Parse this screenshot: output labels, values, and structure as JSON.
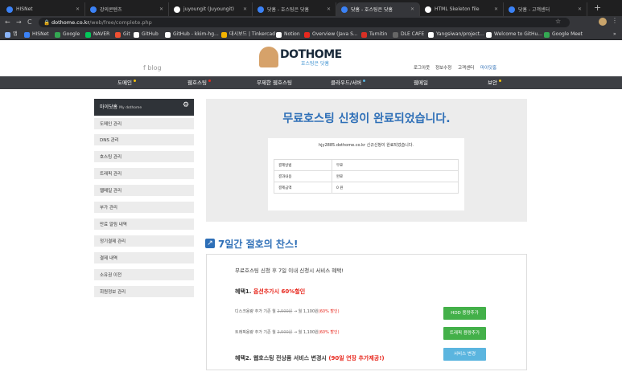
{
  "browser": {
    "tabs": [
      {
        "title": "HISNet",
        "color": "#3b82f6"
      },
      {
        "title": "강의콘텐츠",
        "color": "#3b82f6"
      },
      {
        "title": "juyoungit (Juyoungit)",
        "color": "#ffffff"
      },
      {
        "title": "닷홈 - 호스팅은 닷홈",
        "color": "#3b82f6"
      },
      {
        "title": "닷홈 - 호스팅은 닷홈",
        "color": "#3b82f6"
      },
      {
        "title": "HTML Skeleton file",
        "color": "#ffffff"
      },
      {
        "title": "닷홈 - 고객센터",
        "color": "#3b82f6"
      }
    ],
    "new_tab": "+",
    "back": "←",
    "forward": "→",
    "reload": "C",
    "url_host": "dothome.co.kr",
    "url_path": "/web/free/complete.php",
    "bookmarks": [
      {
        "label": "앱",
        "color": "#8ab4f8"
      },
      {
        "label": "HISNet",
        "color": "#3b82f6"
      },
      {
        "label": "Google",
        "color": "#34a853"
      },
      {
        "label": "NAVER",
        "color": "#03c75a"
      },
      {
        "label": "Git",
        "color": "#f05032"
      },
      {
        "label": "GitHub",
        "color": "#ffffff"
      },
      {
        "label": "GitHub - kkim-hg...",
        "color": "#ffffff"
      },
      {
        "label": "대시보드 | Tinkercad",
        "color": "#f4b400"
      },
      {
        "label": "Notion",
        "color": "#ffffff"
      },
      {
        "label": "Overview (Java S...",
        "color": "#e8281e"
      },
      {
        "label": "Turnitin",
        "color": "#d93025"
      },
      {
        "label": "DLE CAFE",
        "color": "#666666"
      },
      {
        "label": "Yangsiwan/project...",
        "color": "#ffffff"
      },
      {
        "label": "Welcome to GitHu...",
        "color": "#ffffff"
      },
      {
        "label": "Google Meet",
        "color": "#34a853"
      }
    ],
    "more": "»"
  },
  "site": {
    "logo_text": "DOTHOME",
    "logo_sub": "호스팅은 닷홈",
    "blog": "f  blog",
    "top_links": [
      "로그아웃",
      "정보수정",
      "고객센터",
      "마이닷홈"
    ],
    "nav": [
      {
        "label": "도메인",
        "dot": "#f4c20d"
      },
      {
        "label": "웹호스팅",
        "dot": "#e8281e"
      },
      {
        "label": "무제한 웹호스팅",
        "dot": ""
      },
      {
        "label": "클라우드/서버",
        "dot": "#5bb5df"
      },
      {
        "label": "웹메일",
        "dot": ""
      },
      {
        "label": "보안",
        "dot": "#f4c20d"
      }
    ]
  },
  "sidebar": {
    "title": "마이닷홈",
    "title_sub": "My dothome",
    "items": [
      "도메인 관리",
      "DNS 관리",
      "호스팅 관리",
      "트래픽 관리",
      "웹메일 관리",
      "부가 관리",
      "만료 알림 내역",
      "정기결제 관리",
      "결제 내역",
      "소유권 이전",
      "회원정보 관리"
    ]
  },
  "main": {
    "title": "무료호스팅 신청이 완료되었습니다.",
    "notice": "hjy2885.dothome.co.kr 신규신청이 완료되었습니다.",
    "rows": [
      {
        "label": "결제방법",
        "value": "무료"
      },
      {
        "label": "결과내용",
        "value": "완료"
      },
      {
        "label": "결제금액",
        "value": "0 원"
      }
    ]
  },
  "promo": {
    "title": "7일간 절호의 찬스!",
    "lead": "무료호스팅 신청 후 7일 이내 신청시 서비스 혜택!",
    "benefit1_prefix": "혜택1. ",
    "benefit1_red": "옵션추가시 60%할인",
    "disk_prefix": "디스크용량 추가 기존 월 ",
    "disk_old": "2,500원",
    "disk_mid": " → 월 1,100원",
    "disk_red": "(60% 할인)",
    "disk_button": "HDD 용량추가",
    "traffic_prefix": "트래픽용량 추가 기존 월 ",
    "traffic_old": "2,500원",
    "traffic_mid": " → 월 1,100원",
    "traffic_red": "(60% 할인)",
    "traffic_button": "트래픽 용량추가",
    "benefit2_prefix": "혜택2. 웹호스팅 전상품 서비스 변경시 ",
    "benefit2_red": "(90일 연장 추가제공!)",
    "change_button": "서비스 변경"
  }
}
